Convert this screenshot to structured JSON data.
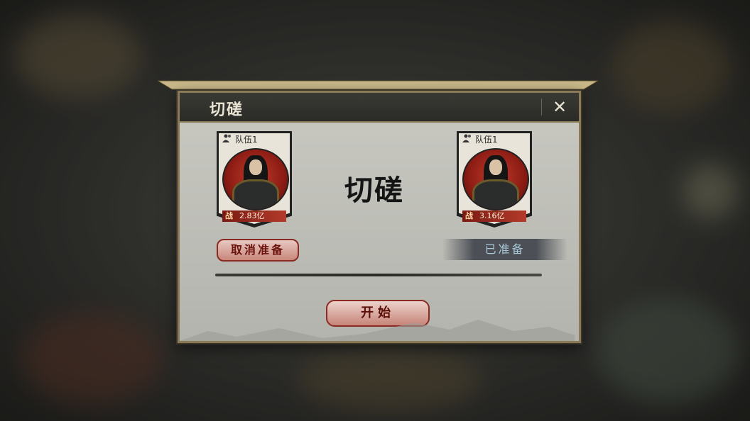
{
  "dialog": {
    "title": "切磋",
    "close_icon": "close-icon",
    "center_title": "切磋"
  },
  "teams": [
    {
      "label": "队伍1",
      "power_icon": "战",
      "power": "2.83亿",
      "hero": "armored-warrior"
    },
    {
      "label": "队伍1",
      "power_icon": "战",
      "power": "3.16亿",
      "hero": "armored-warrior"
    }
  ],
  "actions": {
    "cancel_ready": "取消准备",
    "ready_status": "已准备",
    "start": "开始"
  },
  "colors": {
    "accent_red": "#8a2a22",
    "ready_text": "#a9c9d9",
    "header_bg": "#2a2a26"
  }
}
